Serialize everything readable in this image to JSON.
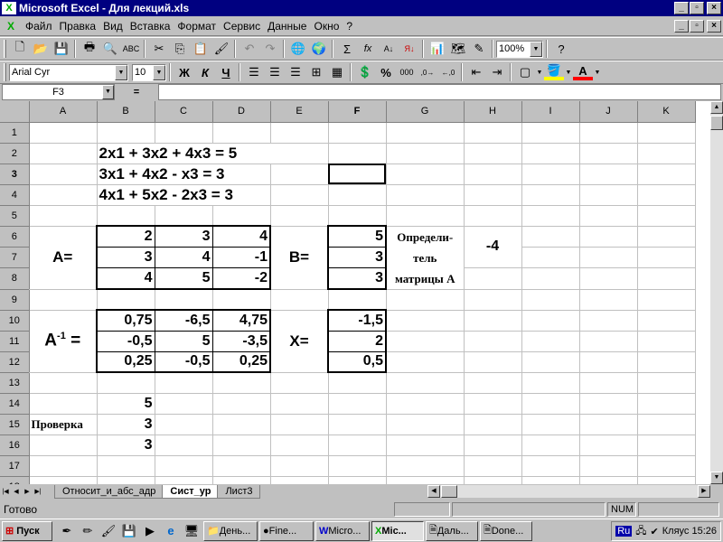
{
  "window": {
    "title": "Microsoft Excel - Для лекций.xls"
  },
  "menu": [
    "Файл",
    "Правка",
    "Вид",
    "Вставка",
    "Формат",
    "Сервис",
    "Данные",
    "Окно",
    "?"
  ],
  "toolbar": {
    "zoom": "100%",
    "font": "Arial Cyr",
    "font_size": "10",
    "bold": "Ж",
    "italic": "К",
    "underline": "Ч",
    "percent": "%",
    "sum": "Σ",
    "fx": "fx"
  },
  "formula": {
    "namebox": "F3",
    "equals": "="
  },
  "columns": [
    "A",
    "B",
    "C",
    "D",
    "E",
    "F",
    "G",
    "H",
    "I",
    "J",
    "K"
  ],
  "rows": [
    "1",
    "2",
    "3",
    "4",
    "5",
    "6",
    "7",
    "8",
    "9",
    "10",
    "11",
    "12",
    "13",
    "14",
    "15",
    "16",
    "17",
    "18"
  ],
  "cells": {
    "eq1": "2x1 + 3x2  + 4x3  = 5",
    "eq2": "3x1 + 4x2   -   x3  = 3",
    "eq3": "4x1 + 5x2   - 2x3  = 3",
    "A_label": "A=",
    "B_label": "B=",
    "X_label": "X=",
    "Ainv_label": "A",
    "Ainv_sup": "-1",
    "Ainv_eq": " =",
    "det_label_1": "Определи-",
    "det_label_2": "тель",
    "det_label_3": "матрицы А",
    "det_value": "-4",
    "check_label": "Проверка",
    "A": [
      [
        "2",
        "3",
        "4"
      ],
      [
        "3",
        "4",
        "-1"
      ],
      [
        "4",
        "5",
        "-2"
      ]
    ],
    "B": [
      "5",
      "3",
      "3"
    ],
    "Ainv": [
      [
        "0,75",
        "-6,5",
        "4,75"
      ],
      [
        "-0,5",
        "5",
        "-3,5"
      ],
      [
        "0,25",
        "-0,5",
        "0,25"
      ]
    ],
    "X": [
      "-1,5",
      "2",
      "0,5"
    ],
    "check": [
      "5",
      "3",
      "3"
    ]
  },
  "sheets": [
    "Относит_и_абс_адр",
    "Сист_ур",
    "Лист3"
  ],
  "active_sheet": "Сист_ур",
  "status": {
    "ready": "Готово",
    "num": "NUM"
  },
  "taskbar": {
    "start": "Пуск",
    "tasks": [
      "День...",
      "Fine...",
      "Micro...",
      "Mic...",
      "Даль...",
      "Done..."
    ],
    "active_task": "Mic...",
    "lang": "Ru",
    "clock": "Кляус 15:26"
  }
}
